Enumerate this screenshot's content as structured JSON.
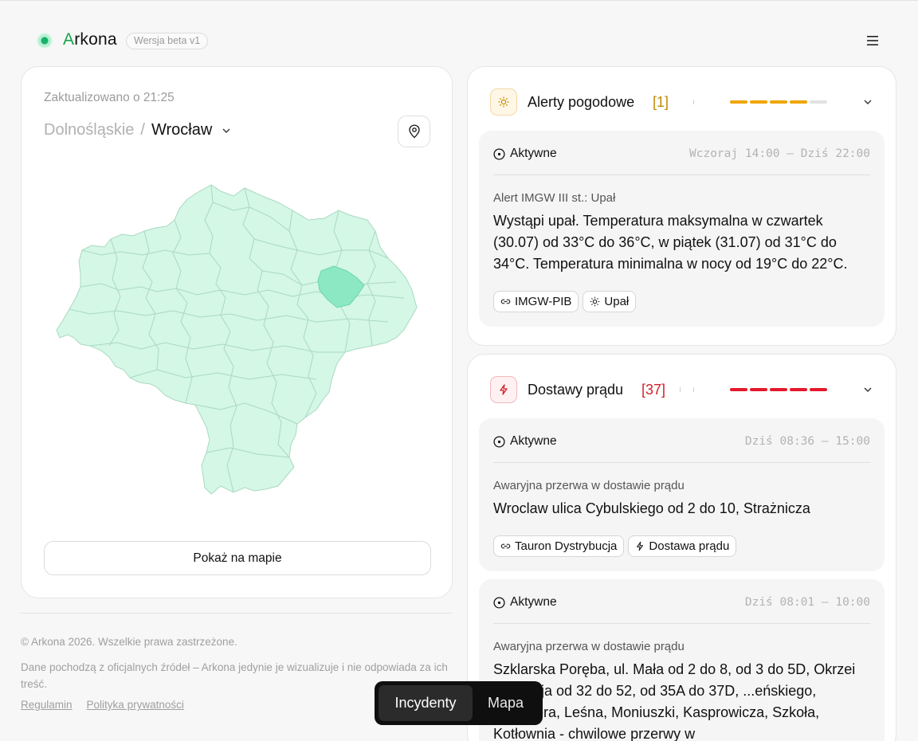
{
  "header": {
    "brand_first": "A",
    "brand_rest": "rkona",
    "beta_label": "Wersja beta v1"
  },
  "location": {
    "updated": "Zaktualizowano o 21:25",
    "region": "Dolnośląskie",
    "separator": "/",
    "city": "Wrocław",
    "show_map_label": "Pokaż na mapie"
  },
  "footer": {
    "copyright": "© Arkona 2026. Wszelkie prawa zastrzeżone.",
    "disclaimer": "Dane pochodzą z oficjalnych źródeł – Arkona jedynie je wizualizuje i nie odpowiada za ich treść.",
    "terms": "Regulamin",
    "privacy": "Polityka prywatności"
  },
  "categories": [
    {
      "title": "Alerty pogodowe",
      "count": "[1]",
      "accent": "#c28a00",
      "severity_filled": 4,
      "severity_total": 5,
      "severity_color": "#f0a500",
      "incidents": [
        {
          "status": "Aktywne",
          "time": "Wczoraj 14:00 – Dziś 22:00",
          "type": "Alert IMGW III st.: Upał",
          "description": "Wystąpi upał. Temperatura maksymalna w czwartek (30.07) od 33°C do 36°C, w piątek (31.07) od 31°C do 34°C. Temperatura minimalna w nocy od 19°C do 22°C.",
          "tags": [
            "IMGW-PIB",
            "Upał"
          ]
        }
      ]
    },
    {
      "title": "Dostawy prądu",
      "count": "[37]",
      "accent": "#d1202a",
      "severity_filled": 5,
      "severity_total": 5,
      "severity_color": "#e3192b",
      "incidents": [
        {
          "status": "Aktywne",
          "time": "Dziś 08:36 – 15:00",
          "type": "Awaryjna przerwa w dostawie prądu",
          "description": "Wroclaw ulica Cybulskiego od 2 do 10, Strażnicza",
          "tags": [
            "Tauron Dystrybucja",
            "Dostawa prądu"
          ]
        },
        {
          "status": "Aktywne",
          "time": "Dziś 08:01 – 10:00",
          "type": "Awaryjna przerwa w dostawie prądu",
          "description": "Szklarska Poręba, ul. Mała od 2 do 8, od 3 do 5D, Okrzei ... 1 Maja od 32 do 52, od 35A do 37D, ...eńskiego, Tetmajera, Leśna, Moniuszki, Kasprowicza, Szkoła, Kotłownia - chwilowe przerwy w",
          "tags": []
        }
      ]
    }
  ],
  "nav": {
    "incidents": "Incydenty",
    "map": "Mapa"
  },
  "colors": {
    "map_fill": "#d4f7e6",
    "map_stroke": "#a9d9c2",
    "map_highlight": "#8ce8c3"
  }
}
